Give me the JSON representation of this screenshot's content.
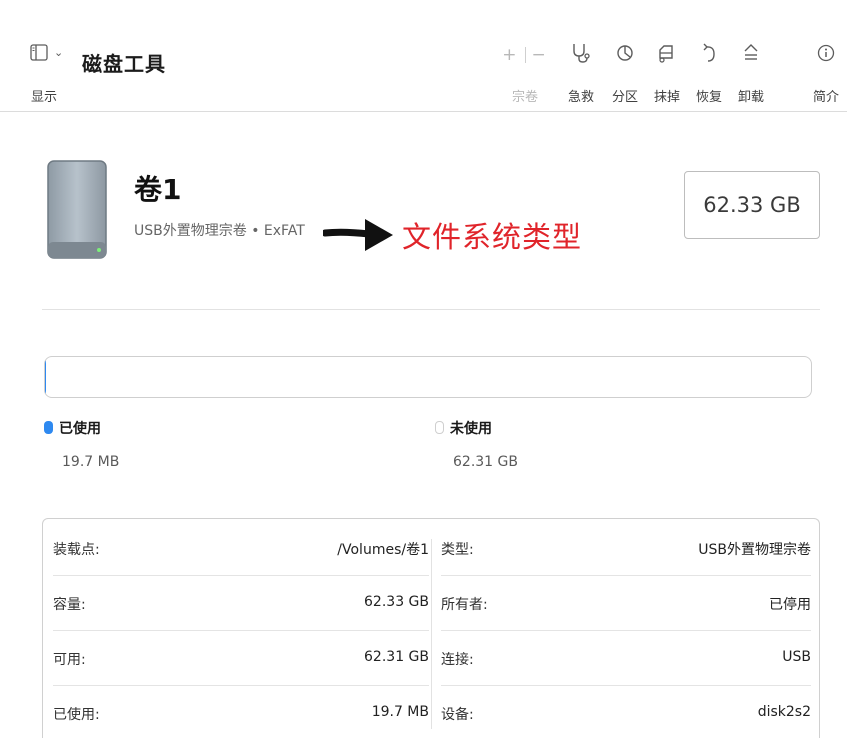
{
  "toolbar": {
    "view_label": "显示",
    "app_title": "磁盘工具",
    "volume_label": "宗卷",
    "tools": [
      {
        "label": "急救",
        "icon": "stethoscope-icon",
        "glyph": "𝒱"
      },
      {
        "label": "分区",
        "icon": "partition-icon",
        "glyph": "◔"
      },
      {
        "label": "抹掉",
        "icon": "erase-icon",
        "glyph": "⛍"
      },
      {
        "label": "恢复",
        "icon": "restore-icon",
        "glyph": "↺"
      },
      {
        "label": "卸载",
        "icon": "eject-icon",
        "glyph": "⏏"
      },
      {
        "label": "简介",
        "icon": "info-icon",
        "glyph": "ⓘ"
      }
    ]
  },
  "volume": {
    "name": "卷1",
    "subtitle": "USB外置物理宗卷 • ExFAT",
    "capacity": "62.33 GB"
  },
  "annotation": {
    "text": "文件系统类型",
    "color": "#e0242a"
  },
  "usage": {
    "used_label": "已使用",
    "used_value": "19.7 MB",
    "free_label": "未使用",
    "free_value": "62.31 GB",
    "used_fraction": 0.0003,
    "used_color": "#2e89f0"
  },
  "info": {
    "left": [
      {
        "key": "装载点:",
        "value": "/Volumes/卷1"
      },
      {
        "key": "容量:",
        "value": "62.33 GB"
      },
      {
        "key": "可用:",
        "value": "62.31 GB"
      },
      {
        "key": "已使用:",
        "value": "19.7 MB"
      }
    ],
    "right": [
      {
        "key": "类型:",
        "value": "USB外置物理宗卷"
      },
      {
        "key": "所有者:",
        "value": "已停用"
      },
      {
        "key": "连接:",
        "value": "USB"
      },
      {
        "key": "设备:",
        "value": "disk2s2"
      }
    ]
  }
}
